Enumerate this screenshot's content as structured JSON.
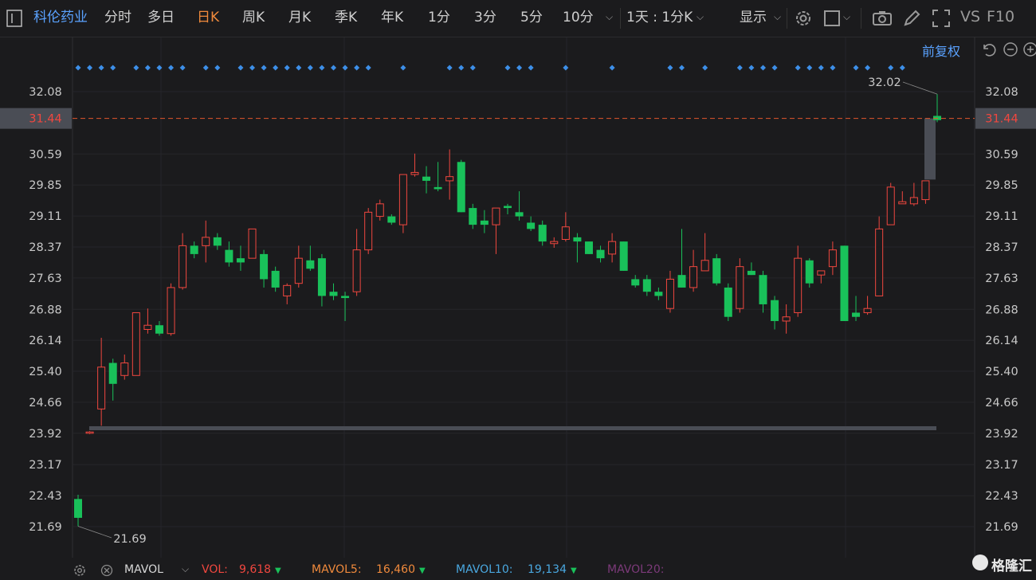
{
  "toolbar": {
    "stock_name": "科伦药业",
    "tabs": [
      "分时",
      "多日",
      "日K",
      "周K",
      "月K",
      "季K",
      "年K",
      "1分",
      "3分",
      "5分",
      "10分"
    ],
    "active_tab": "日K",
    "period_selector": "1天 : 1分K",
    "display_label": "显示",
    "vs_label": "VS",
    "f10_label": "F10",
    "adjust_label": "前复权"
  },
  "colors": {
    "up": "#f0473f",
    "down": "#19c15a",
    "current_price_line": "#e2552c",
    "marker": "#3d8fe8",
    "background": "#1b1b1d"
  },
  "chart_data": {
    "type": "candlestick",
    "title": "",
    "price_axis": {
      "ticks": [
        "32.08",
        "30.59",
        "29.85",
        "29.11",
        "28.37",
        "27.63",
        "26.88",
        "26.14",
        "25.40",
        "24.66",
        "23.92",
        "23.17",
        "22.43",
        "21.69"
      ],
      "range": [
        21.2,
        32.9
      ]
    },
    "current_price": "31.44",
    "high_label": "32.02",
    "low_label": "21.69",
    "candles": [
      {
        "o": 22.35,
        "h": 22.45,
        "l": 21.7,
        "c": 21.9
      },
      {
        "o": 23.92,
        "h": 23.97,
        "l": 23.9,
        "c": 23.95
      },
      {
        "o": 24.5,
        "h": 26.2,
        "l": 24.1,
        "c": 25.5
      },
      {
        "o": 25.6,
        "h": 25.7,
        "l": 24.7,
        "c": 25.1
      },
      {
        "o": 25.3,
        "h": 25.8,
        "l": 25.2,
        "c": 25.6
      },
      {
        "o": 25.3,
        "h": 26.8,
        "l": 25.3,
        "c": 26.8
      },
      {
        "o": 26.4,
        "h": 26.9,
        "l": 26.3,
        "c": 26.5
      },
      {
        "o": 26.5,
        "h": 26.6,
        "l": 26.25,
        "c": 26.3
      },
      {
        "o": 26.3,
        "h": 27.5,
        "l": 26.25,
        "c": 27.4
      },
      {
        "o": 27.4,
        "h": 28.7,
        "l": 27.35,
        "c": 28.4
      },
      {
        "o": 28.4,
        "h": 28.5,
        "l": 28.1,
        "c": 28.2
      },
      {
        "o": 28.4,
        "h": 29.0,
        "l": 28.0,
        "c": 28.6
      },
      {
        "o": 28.6,
        "h": 28.7,
        "l": 28.3,
        "c": 28.4
      },
      {
        "o": 28.3,
        "h": 28.5,
        "l": 27.9,
        "c": 28.0
      },
      {
        "o": 28.1,
        "h": 28.4,
        "l": 27.8,
        "c": 28.0
      },
      {
        "o": 28.1,
        "h": 28.8,
        "l": 28.1,
        "c": 28.8
      },
      {
        "o": 28.2,
        "h": 28.3,
        "l": 27.4,
        "c": 27.6
      },
      {
        "o": 27.8,
        "h": 27.9,
        "l": 27.3,
        "c": 27.4
      },
      {
        "o": 27.2,
        "h": 27.5,
        "l": 27.0,
        "c": 27.45
      },
      {
        "o": 27.5,
        "h": 28.4,
        "l": 27.4,
        "c": 28.1
      },
      {
        "o": 28.05,
        "h": 28.4,
        "l": 27.8,
        "c": 27.85
      },
      {
        "o": 28.1,
        "h": 28.2,
        "l": 26.95,
        "c": 27.2
      },
      {
        "o": 27.3,
        "h": 27.5,
        "l": 27.1,
        "c": 27.2
      },
      {
        "o": 27.2,
        "h": 27.3,
        "l": 26.6,
        "c": 27.15
      },
      {
        "o": 27.3,
        "h": 28.8,
        "l": 27.2,
        "c": 28.3
      },
      {
        "o": 28.3,
        "h": 29.3,
        "l": 28.2,
        "c": 29.2
      },
      {
        "o": 29.1,
        "h": 29.5,
        "l": 29.0,
        "c": 29.4
      },
      {
        "o": 29.1,
        "h": 29.15,
        "l": 28.9,
        "c": 28.95
      },
      {
        "o": 28.9,
        "h": 30.0,
        "l": 28.7,
        "c": 30.1
      },
      {
        "o": 30.1,
        "h": 30.6,
        "l": 30.05,
        "c": 30.15
      },
      {
        "o": 30.05,
        "h": 30.3,
        "l": 29.65,
        "c": 29.95
      },
      {
        "o": 29.8,
        "h": 30.4,
        "l": 29.7,
        "c": 29.75
      },
      {
        "o": 29.95,
        "h": 30.7,
        "l": 29.5,
        "c": 30.05
      },
      {
        "o": 30.4,
        "h": 30.45,
        "l": 29.2,
        "c": 29.2
      },
      {
        "o": 29.3,
        "h": 29.4,
        "l": 28.8,
        "c": 28.9
      },
      {
        "o": 29.0,
        "h": 29.25,
        "l": 28.7,
        "c": 28.9
      },
      {
        "o": 28.9,
        "h": 29.3,
        "l": 28.2,
        "c": 29.3
      },
      {
        "o": 29.35,
        "h": 29.4,
        "l": 29.15,
        "c": 29.3
      },
      {
        "o": 29.2,
        "h": 29.7,
        "l": 29.0,
        "c": 29.1
      },
      {
        "o": 28.95,
        "h": 29.1,
        "l": 28.75,
        "c": 28.8
      },
      {
        "o": 28.9,
        "h": 29.0,
        "l": 28.4,
        "c": 28.5
      },
      {
        "o": 28.45,
        "h": 28.6,
        "l": 28.35,
        "c": 28.5
      },
      {
        "o": 28.55,
        "h": 29.2,
        "l": 28.5,
        "c": 28.85
      },
      {
        "o": 28.6,
        "h": 28.7,
        "l": 28.0,
        "c": 28.5
      },
      {
        "o": 28.5,
        "h": 28.5,
        "l": 28.2,
        "c": 28.2
      },
      {
        "o": 28.3,
        "h": 28.4,
        "l": 28.0,
        "c": 28.1
      },
      {
        "o": 28.2,
        "h": 28.7,
        "l": 28.0,
        "c": 28.5
      },
      {
        "o": 28.5,
        "h": 28.5,
        "l": 27.8,
        "c": 27.8
      },
      {
        "o": 27.6,
        "h": 27.7,
        "l": 27.4,
        "c": 27.45
      },
      {
        "o": 27.6,
        "h": 27.7,
        "l": 27.2,
        "c": 27.3
      },
      {
        "o": 27.3,
        "h": 27.4,
        "l": 27.1,
        "c": 27.2
      },
      {
        "o": 26.9,
        "h": 27.8,
        "l": 26.8,
        "c": 27.6
      },
      {
        "o": 27.7,
        "h": 28.8,
        "l": 27.4,
        "c": 27.4
      },
      {
        "o": 27.4,
        "h": 28.3,
        "l": 27.3,
        "c": 27.9
      },
      {
        "o": 27.8,
        "h": 28.7,
        "l": 27.8,
        "c": 28.05
      },
      {
        "o": 28.1,
        "h": 28.2,
        "l": 27.45,
        "c": 27.5
      },
      {
        "o": 27.4,
        "h": 27.5,
        "l": 26.6,
        "c": 26.7
      },
      {
        "o": 26.9,
        "h": 28.1,
        "l": 26.8,
        "c": 27.9
      },
      {
        "o": 27.8,
        "h": 28.0,
        "l": 27.7,
        "c": 27.7
      },
      {
        "o": 27.7,
        "h": 27.8,
        "l": 26.8,
        "c": 27.0
      },
      {
        "o": 27.1,
        "h": 27.2,
        "l": 26.4,
        "c": 26.6
      },
      {
        "o": 26.6,
        "h": 27.0,
        "l": 26.3,
        "c": 26.7
      },
      {
        "o": 26.8,
        "h": 28.4,
        "l": 26.7,
        "c": 28.1
      },
      {
        "o": 28.05,
        "h": 28.1,
        "l": 27.4,
        "c": 27.5
      },
      {
        "o": 27.7,
        "h": 27.8,
        "l": 27.5,
        "c": 27.8
      },
      {
        "o": 27.9,
        "h": 28.5,
        "l": 27.7,
        "c": 28.3
      },
      {
        "o": 28.4,
        "h": 28.4,
        "l": 26.6,
        "c": 26.6
      },
      {
        "o": 26.8,
        "h": 27.2,
        "l": 26.6,
        "c": 26.7
      },
      {
        "o": 26.8,
        "h": 27.2,
        "l": 26.75,
        "c": 26.9
      },
      {
        "o": 27.2,
        "h": 29.1,
        "l": 27.2,
        "c": 28.8
      },
      {
        "o": 28.9,
        "h": 29.9,
        "l": 28.9,
        "c": 29.8
      },
      {
        "o": 29.4,
        "h": 29.7,
        "l": 29.4,
        "c": 29.45
      },
      {
        "o": 29.4,
        "h": 29.9,
        "l": 29.35,
        "c": 29.55
      },
      {
        "o": 29.5,
        "h": 29.95,
        "l": 29.4,
        "c": 29.95
      },
      {
        "o": 31.5,
        "h": 32.02,
        "l": 31.35,
        "c": 31.4
      }
    ],
    "markers_note": "blue diamond markers above candles",
    "marker_indices": [
      0,
      1,
      2,
      3,
      5,
      6,
      7,
      8,
      9,
      11,
      12,
      14,
      15,
      16,
      17,
      18,
      19,
      20,
      21,
      22,
      23,
      24,
      25,
      28,
      32,
      33,
      34,
      37,
      38,
      39,
      42,
      46,
      51,
      52,
      54,
      57,
      58,
      59,
      60,
      62,
      63,
      64,
      65,
      67,
      68,
      70,
      71
    ],
    "volume_indicator": {
      "name": "MAVOL",
      "vol_label": "VOL:",
      "vol_value": "9,618",
      "mavol5_label": "MAVOL5:",
      "mavol5_value": "16,460",
      "mavol10_label": "MAVOL10:",
      "mavol10_value": "19,134",
      "mavol20_label": "MAVOL20:"
    },
    "watermark": "格隆汇"
  }
}
